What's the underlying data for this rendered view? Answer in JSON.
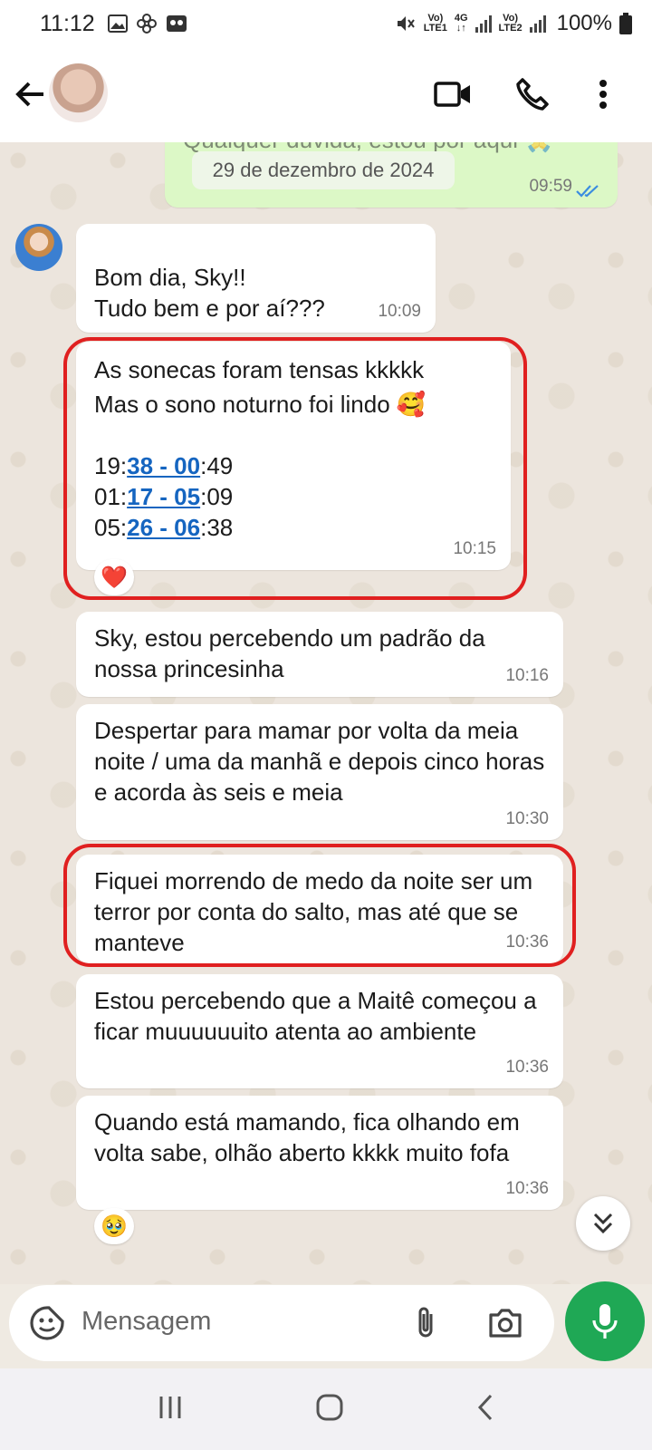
{
  "status_bar": {
    "time": "11:12",
    "network1": {
      "top": "Vo)",
      "bottom": "LTE1",
      "tech": "4G"
    },
    "network2": {
      "top": "Vo)",
      "bottom": "LTE2"
    },
    "battery": "100%"
  },
  "chat": {
    "date_chip": "29 de dezembro de 2024",
    "top_partial_text": "Qualquer dúvida, estou por aqui 🙏",
    "top_partial_time": "09:59",
    "messages": [
      {
        "lines": [
          "Bom dia, Sky!!",
          "Tudo bem e por aí???"
        ],
        "time": "10:09"
      },
      {
        "lines": [
          "As sonecas foram tensas kkkkk",
          "Mas o sono noturno foi lindo 🥰"
        ],
        "sleep_times": [
          {
            "pre": "19:",
            "link": "38 - 00",
            "post": ":49"
          },
          {
            "pre": "01:",
            "link": "17 - 05",
            "post": ":09"
          },
          {
            "pre": "05:",
            "link": "26 - 06",
            "post": ":38"
          }
        ],
        "time": "10:15",
        "reaction": "❤️"
      },
      {
        "text": "Sky, estou percebendo um padrão da nossa princesinha",
        "time": "10:16"
      },
      {
        "text": "Despertar para mamar por volta da meia noite / uma da manhã e depois cinco horas e acorda às seis e meia",
        "time": "10:30"
      },
      {
        "text": "Fiquei morrendo de medo da noite ser um terror por conta do salto, mas até que se manteve",
        "time": "10:36"
      },
      {
        "text": "Estou percebendo que a Maitê começou a ficar muuuuuuito atenta ao ambiente",
        "time": "10:36"
      },
      {
        "text": "Quando está mamando, fica olhando em volta sabe, olhão aberto kkkk muito fofa",
        "time": "10:36",
        "reaction": "🥹"
      }
    ]
  },
  "input": {
    "placeholder": "Mensagem"
  },
  "icons": [
    "back-arrow-icon",
    "video-call-icon",
    "phone-call-icon",
    "more-options-icon",
    "sticker-icon",
    "attach-icon",
    "camera-icon",
    "mic-icon",
    "chevron-down-double-icon"
  ],
  "colors": {
    "accent_green": "#1fa855",
    "outgoing_bubble": "#dcf8c6",
    "highlight_ring": "#e02020",
    "link_blue": "#1565c0"
  }
}
